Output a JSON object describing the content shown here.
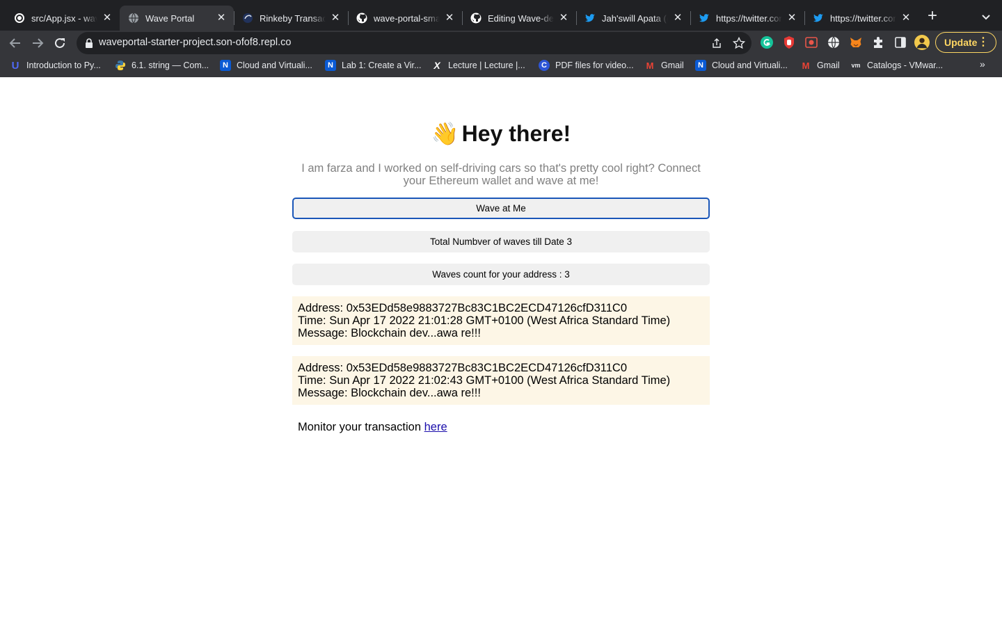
{
  "browser": {
    "tabs": [
      {
        "title": "src/App.jsx - wave",
        "icon": "replit-icon",
        "active": false
      },
      {
        "title": "Wave Portal",
        "icon": "globe-icon",
        "active": true
      },
      {
        "title": "Rinkeby Transacti",
        "icon": "etherscan-icon",
        "active": false
      },
      {
        "title": "wave-portal-smar",
        "icon": "github-icon",
        "active": false
      },
      {
        "title": "Editing Wave-dec",
        "icon": "github-icon",
        "active": false
      },
      {
        "title": "Jah'swill Apata (@",
        "icon": "twitter-icon",
        "active": false
      },
      {
        "title": "https://twitter.cor",
        "icon": "twitter-icon",
        "active": false
      },
      {
        "title": "https://twitter.cor",
        "icon": "twitter-icon",
        "active": false
      }
    ],
    "url": "waveportal-starter-project.son-ofof8.repl.co",
    "update_label": "Update",
    "bookmarks": [
      {
        "label": "Introduction to Py...",
        "icon": "U",
        "color": "#4f6af7"
      },
      {
        "label": "6.1. string — Com...",
        "icon": "py",
        "color": "#3b77a8"
      },
      {
        "label": "Cloud and Virtuali...",
        "icon": "N",
        "color": "#0a5ad4"
      },
      {
        "label": "Lab 1: Create a Vir...",
        "icon": "N",
        "color": "#0a5ad4"
      },
      {
        "label": "Lecture | Lecture |...",
        "icon": "X",
        "color": "#202124"
      },
      {
        "label": "PDF files for video...",
        "icon": "C",
        "color": "#2d55d6"
      },
      {
        "label": "Gmail",
        "icon": "M",
        "color": "#ea4335"
      },
      {
        "label": "Cloud and Virtuali...",
        "icon": "N",
        "color": "#0a5ad4"
      },
      {
        "label": "Gmail",
        "icon": "M",
        "color": "#ea4335"
      },
      {
        "label": "Catalogs - VMwar...",
        "icon": "vm",
        "color": "#5f6368"
      }
    ]
  },
  "app": {
    "wave_emoji": "👋",
    "title": "Hey there!",
    "bio": "I am farza and I worked on self-driving cars so that's pretty cool right? Connect your Ethereum wallet and wave at me!",
    "wave_button": "Wave at Me",
    "total_waves_label": "Total Numbver of waves till Date 3",
    "your_waves_label": "Waves count for your address : 3",
    "waves": [
      {
        "address": "Address: 0x53EDd58e9883727Bc83C1BC2ECD47126cfD311C0",
        "time": "Time: Sun Apr 17 2022 21:01:28 GMT+0100 (West Africa Standard Time)",
        "message": "Message: Blockchain dev...awa re!!!"
      },
      {
        "address": "Address: 0x53EDd58e9883727Bc83C1BC2ECD47126cfD311C0",
        "time": "Time: Sun Apr 17 2022 21:02:43 GMT+0100 (West Africa Standard Time)",
        "message": "Message: Blockchain dev...awa re!!!"
      }
    ],
    "monitor_text": "Monitor your transaction ",
    "monitor_link": "here"
  }
}
